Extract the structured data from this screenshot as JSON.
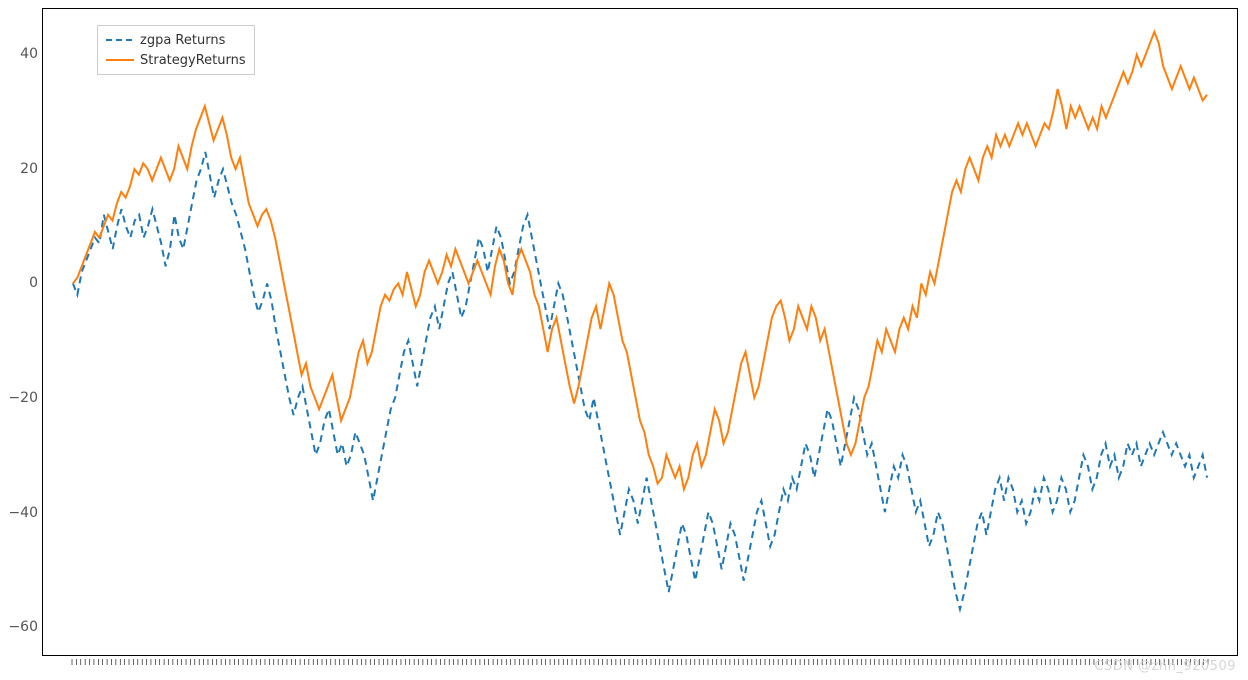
{
  "legend": {
    "items": [
      {
        "name": "zgpa-returns",
        "label": "zgpa Returns",
        "color": "#1f77b4",
        "dash": "6,4"
      },
      {
        "name": "strategy-returns",
        "label": "StrategyReturns",
        "color": "#ff7f0e",
        "dash": ""
      }
    ]
  },
  "yaxis": {
    "ticks": [
      40,
      20,
      0,
      -20,
      -40,
      -60
    ],
    "range": [
      -65,
      48
    ]
  },
  "xaxis": {
    "n": 260,
    "first_label": ""
  },
  "watermark": "CSDN @zhh_920509",
  "chart_data": {
    "type": "line",
    "title": "",
    "xlabel": "",
    "ylabel": "",
    "ylim": [
      -65,
      48
    ],
    "x": "0..259 (trading-day index)",
    "series": [
      {
        "name": "zgpa Returns",
        "color": "#1f77b4",
        "style": "dashed",
        "values": [
          0,
          -2,
          2,
          4,
          6,
          8,
          7,
          12,
          9,
          6,
          10,
          13,
          10,
          8,
          11,
          12,
          8,
          10,
          13,
          10,
          7,
          3,
          6,
          12,
          8,
          6,
          10,
          14,
          18,
          20,
          23,
          19,
          15,
          18,
          20,
          17,
          14,
          12,
          9,
          6,
          2,
          -2,
          -5,
          -3,
          0,
          -3,
          -8,
          -12,
          -16,
          -20,
          -23,
          -20,
          -18,
          -22,
          -26,
          -30,
          -28,
          -24,
          -22,
          -26,
          -30,
          -28,
          -32,
          -30,
          -26,
          -28,
          -30,
          -34,
          -38,
          -34,
          -30,
          -26,
          -22,
          -20,
          -16,
          -12,
          -10,
          -14,
          -18,
          -14,
          -10,
          -6,
          -4,
          -8,
          -4,
          0,
          2,
          -2,
          -6,
          -4,
          0,
          4,
          8,
          6,
          2,
          6,
          10,
          8,
          4,
          0,
          2,
          6,
          10,
          12,
          8,
          4,
          0,
          -4,
          -8,
          -4,
          0,
          -2,
          -6,
          -10,
          -14,
          -18,
          -22,
          -24,
          -20,
          -24,
          -28,
          -32,
          -36,
          -40,
          -44,
          -40,
          -36,
          -38,
          -42,
          -38,
          -34,
          -38,
          -42,
          -46,
          -50,
          -54,
          -50,
          -46,
          -42,
          -44,
          -48,
          -52,
          -48,
          -44,
          -40,
          -42,
          -46,
          -50,
          -46,
          -42,
          -44,
          -48,
          -52,
          -48,
          -44,
          -40,
          -38,
          -42,
          -46,
          -44,
          -40,
          -36,
          -38,
          -34,
          -36,
          -32,
          -28,
          -30,
          -34,
          -30,
          -26,
          -22,
          -24,
          -28,
          -32,
          -28,
          -24,
          -20,
          -22,
          -26,
          -30,
          -28,
          -32,
          -36,
          -40,
          -36,
          -32,
          -34,
          -30,
          -32,
          -36,
          -40,
          -38,
          -42,
          -46,
          -44,
          -40,
          -42,
          -46,
          -50,
          -54,
          -57,
          -54,
          -50,
          -46,
          -42,
          -40,
          -44,
          -40,
          -36,
          -34,
          -38,
          -34,
          -36,
          -40,
          -38,
          -42,
          -40,
          -36,
          -38,
          -34,
          -36,
          -40,
          -38,
          -34,
          -36,
          -40,
          -38,
          -34,
          -30,
          -32,
          -36,
          -34,
          -30,
          -28,
          -32,
          -30,
          -34,
          -32,
          -28,
          -30,
          -28,
          -32,
          -30,
          -28,
          -30,
          -28,
          -26,
          -28,
          -30,
          -28,
          -30,
          -32,
          -30,
          -34,
          -32,
          -30,
          -34
        ]
      },
      {
        "name": "StrategyReturns",
        "color": "#ff7f0e",
        "style": "solid",
        "values": [
          0,
          1,
          3,
          5,
          7,
          9,
          8,
          10,
          12,
          11,
          14,
          16,
          15,
          17,
          20,
          19,
          21,
          20,
          18,
          20,
          22,
          20,
          18,
          20,
          24,
          22,
          20,
          24,
          27,
          29,
          31,
          28,
          25,
          27,
          29,
          26,
          22,
          20,
          22,
          18,
          14,
          12,
          10,
          12,
          13,
          11,
          8,
          4,
          0,
          -4,
          -8,
          -12,
          -16,
          -14,
          -18,
          -20,
          -22,
          -20,
          -18,
          -16,
          -20,
          -24,
          -22,
          -20,
          -16,
          -12,
          -10,
          -14,
          -12,
          -8,
          -4,
          -2,
          -3,
          -1,
          0,
          -2,
          2,
          -1,
          -4,
          -2,
          2,
          4,
          2,
          0,
          2,
          5,
          3,
          6,
          4,
          2,
          0,
          2,
          4,
          2,
          0,
          -2,
          3,
          6,
          4,
          0,
          -2,
          4,
          6,
          4,
          2,
          -2,
          -4,
          -8,
          -12,
          -8,
          -6,
          -10,
          -14,
          -18,
          -21,
          -18,
          -14,
          -10,
          -6,
          -4,
          -8,
          -4,
          0,
          -2,
          -6,
          -10,
          -12,
          -16,
          -20,
          -24,
          -26,
          -30,
          -32,
          -35,
          -34,
          -30,
          -32,
          -34,
          -32,
          -36,
          -34,
          -30,
          -28,
          -32,
          -30,
          -26,
          -22,
          -24,
          -28,
          -26,
          -22,
          -18,
          -14,
          -12,
          -16,
          -20,
          -18,
          -14,
          -10,
          -6,
          -4,
          -3,
          -6,
          -10,
          -8,
          -4,
          -6,
          -8,
          -4,
          -6,
          -10,
          -8,
          -12,
          -16,
          -20,
          -24,
          -28,
          -30,
          -28,
          -24,
          -20,
          -18,
          -14,
          -10,
          -12,
          -8,
          -10,
          -12,
          -8,
          -6,
          -8,
          -4,
          -6,
          0,
          -2,
          2,
          0,
          4,
          8,
          12,
          16,
          18,
          16,
          20,
          22,
          20,
          18,
          22,
          24,
          22,
          26,
          24,
          26,
          24,
          26,
          28,
          26,
          28,
          26,
          24,
          26,
          28,
          27,
          30,
          34,
          31,
          27,
          31,
          29,
          31,
          29,
          27,
          29,
          27,
          31,
          29,
          31,
          33,
          35,
          37,
          35,
          37,
          40,
          38,
          40,
          42,
          44,
          42,
          38,
          36,
          34,
          36,
          38,
          36,
          34,
          36,
          34,
          32,
          33
        ]
      }
    ]
  }
}
